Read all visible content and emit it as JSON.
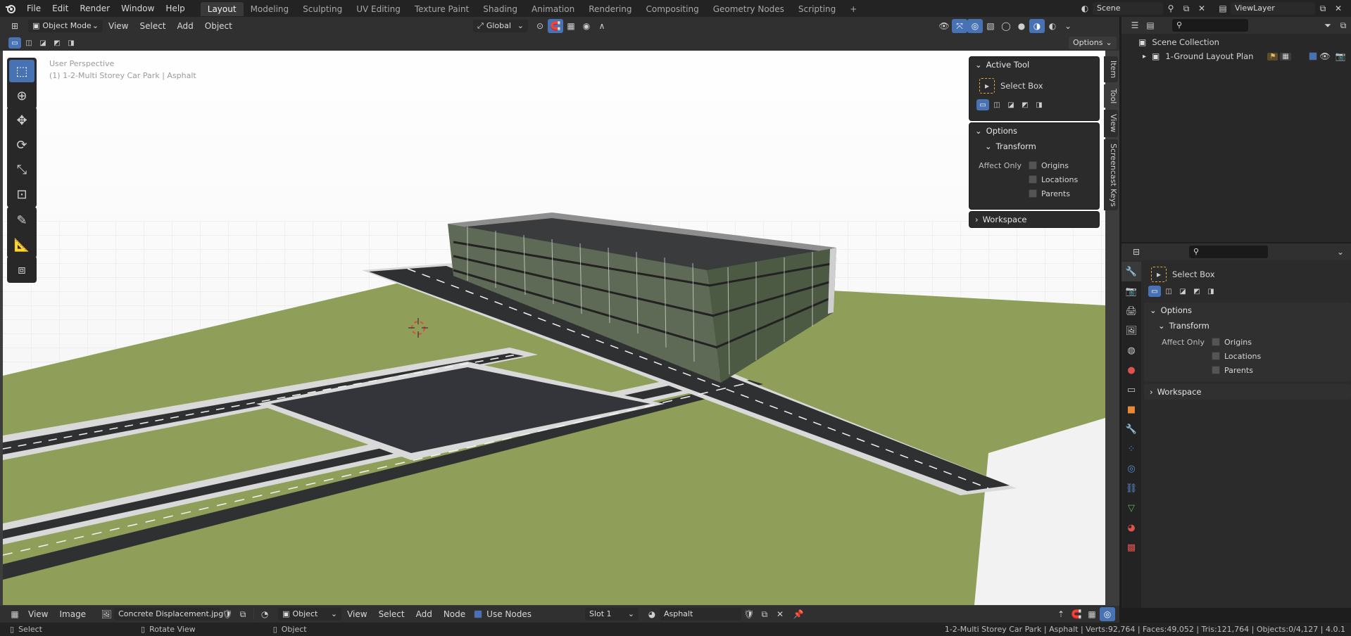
{
  "menubar": {
    "items": [
      "File",
      "Edit",
      "Render",
      "Window",
      "Help"
    ],
    "workspaces": [
      "Layout",
      "Modeling",
      "Sculpting",
      "UV Editing",
      "Texture Paint",
      "Shading",
      "Animation",
      "Rendering",
      "Compositing",
      "Geometry Nodes",
      "Scripting"
    ],
    "active_workspace": "Layout",
    "add_tab": "+",
    "scene_name": "Scene",
    "view_layer": "ViewLayer"
  },
  "viewport": {
    "mode": "Object Mode",
    "menus": [
      "View",
      "Select",
      "Add",
      "Object"
    ],
    "orientation": "Global",
    "options_label": "Options",
    "overlay_title": "User Perspective",
    "overlay_object": "(1) 1-2-Multi Storey Car Park | Asphalt"
  },
  "npanel": {
    "tabs": [
      "Item",
      "Tool",
      "View",
      "Screencast Keys"
    ],
    "active_tool_title": "Active Tool",
    "tool_name": "Select Box",
    "options_title": "Options",
    "transform_title": "Transform",
    "affect_only": "Affect Only",
    "checkboxes": [
      "Origins",
      "Locations",
      "Parents"
    ],
    "workspace_title": "Workspace"
  },
  "outliner": {
    "search_placeholder": "",
    "root": "Scene Collection",
    "collection": "1-Ground Layout Plan"
  },
  "properties": {
    "tool_name": "Select Box",
    "options_title": "Options",
    "transform_title": "Transform",
    "affect_only": "Affect Only",
    "checkboxes": [
      "Origins",
      "Locations",
      "Parents"
    ],
    "workspace_title": "Workspace"
  },
  "bottombar": {
    "image_menus": [
      "View",
      "Image"
    ],
    "image_name": "Concrete Displacement.jpg",
    "object_type": "Object",
    "node_menus": [
      "View",
      "Select",
      "Add",
      "Node"
    ],
    "use_nodes": "Use Nodes",
    "slot": "Slot 1",
    "material": "Asphalt"
  },
  "statusbar": {
    "hints": [
      "Select",
      "Rotate View",
      "Object"
    ],
    "stats": "1-2-Multi Storey Car Park | Asphalt | Verts:92,764 | Faces:49,052 | Tris:121,764 | Objects:0/4,127 | 4.0.1"
  },
  "colors": {
    "accent": "#4772b3",
    "grass": "#8f9f5a",
    "road": "#2f3032",
    "sky": "#ffffff"
  }
}
